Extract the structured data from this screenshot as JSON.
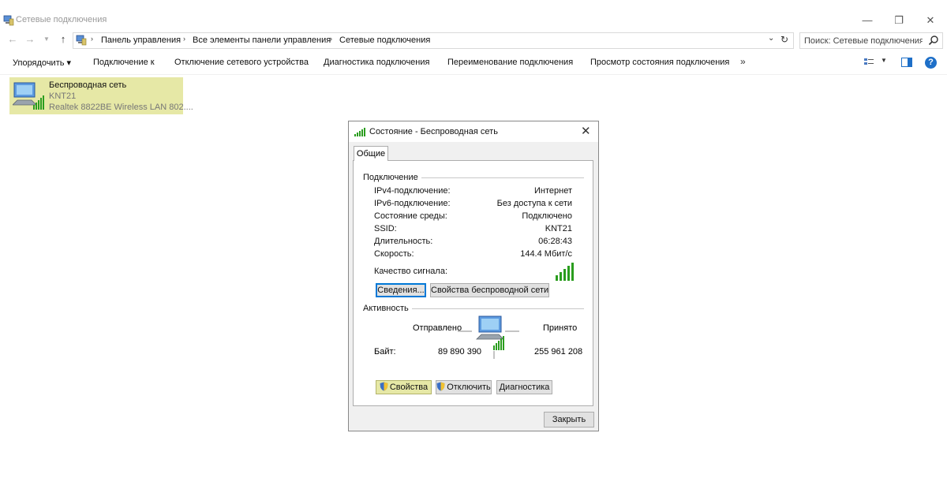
{
  "window": {
    "title": "Сетевые подключения",
    "controls": {
      "minimize": "—",
      "maximize": "❐",
      "close": "✕"
    }
  },
  "address": {
    "crumbs": [
      "Панель управления",
      "Все элементы панели управления",
      "Сетевые подключения"
    ],
    "search_placeholder": "Поиск: Сетевые подключения"
  },
  "commandbar": {
    "organize": "Упорядочить ▾",
    "items": [
      "Подключение к",
      "Отключение сетевого устройства",
      "Диагностика подключения",
      "Переименование подключения",
      "Просмотр состояния подключения"
    ],
    "more": "»",
    "help": "?"
  },
  "connection": {
    "name": "Беспроводная сеть",
    "ssid": "KNT21",
    "adapter": "Realtek 8822BE Wireless LAN 802...."
  },
  "dialog": {
    "title": "Состояние - Беспроводная сеть",
    "close": "✕",
    "tab": "Общие",
    "connection_group": "Подключение",
    "rows": [
      {
        "label": "IPv4-подключение:",
        "value": "Интернет"
      },
      {
        "label": "IPv6-подключение:",
        "value": "Без доступа к сети"
      },
      {
        "label": "Состояние среды:",
        "value": "Подключено"
      },
      {
        "label": "SSID:",
        "value": "KNT21"
      },
      {
        "label": "Длительность:",
        "value": "06:28:43"
      },
      {
        "label": "Скорость:",
        "value": "144.4 Мбит/с"
      }
    ],
    "signal_label": "Качество сигнала:",
    "signal_bars": 5,
    "details_button": "Сведения...",
    "wireless_props_button": "Свойства беспроводной сети",
    "activity_group": "Активность",
    "sent_label": "Отправлено",
    "received_label": "Принято",
    "bytes_label": "Байт:",
    "bytes_sent": "89 890 390",
    "bytes_received": "255 961 208",
    "properties_button": "Свойства",
    "disable_button": "Отключить",
    "diagnose_button": "Диагностика",
    "close_button": "Закрыть"
  },
  "colors": {
    "selection": "#e6e8a6",
    "signal_green": "#2a9d1e",
    "accent_blue": "#0078d7"
  }
}
